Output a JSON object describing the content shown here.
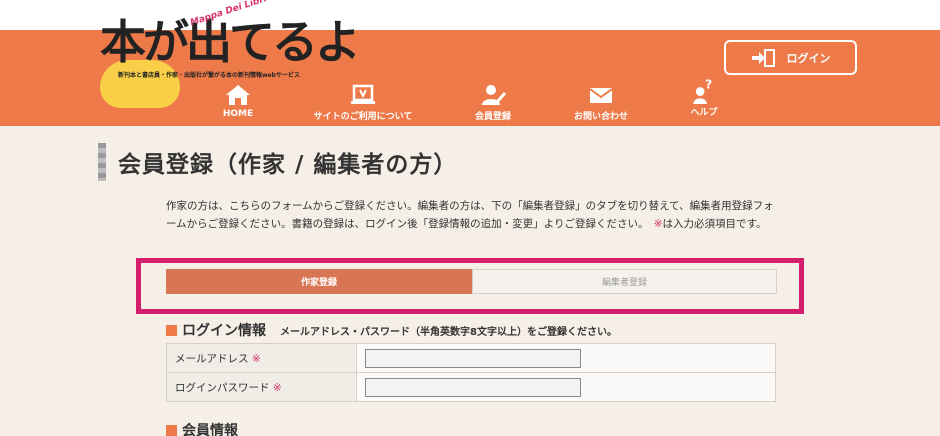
{
  "header": {
    "logo": {
      "title": "本が出てるよ",
      "arc_text": "Mappa Dei Libri .com",
      "tagline": "新刊本と書店員・作家・出版社が繋がる本の新刊情報webサービス"
    },
    "login_label": "ログイン",
    "nav": [
      {
        "label": "HOME",
        "icon": "home-icon"
      },
      {
        "label": "サイトのご利用について",
        "icon": "laptop-icon"
      },
      {
        "label": "会員登録",
        "icon": "user-pen-icon"
      },
      {
        "label": "お問い合わせ",
        "icon": "mail-icon"
      },
      {
        "label": "ヘルプ",
        "icon": "help-icon"
      }
    ]
  },
  "page": {
    "title": "会員登録（作家 / 編集者の方）",
    "intro_text": "作家の方は、こちらのフォームからご登録ください。編集者の方は、下の「編集者登録」のタブを切り替えて、編集者用登録フォームからご登録ください。書籍の登録は、ログイン後「登録情報の追加・変更」よりご登録ください。",
    "required_mark": "※",
    "required_note_suffix": "は入力必須項目です。"
  },
  "tabs": [
    {
      "label": "作家登録",
      "active": true
    },
    {
      "label": "編集者登録",
      "active": false
    }
  ],
  "login_section": {
    "heading": "ログイン情報",
    "note": "メールアドレス・パスワード（半角英数字8文字以上）をご登録ください。",
    "fields": [
      {
        "label": "メールアドレス",
        "value": ""
      },
      {
        "label": "ログインパスワード",
        "value": ""
      }
    ]
  },
  "member_section": {
    "heading": "会員情報"
  },
  "colors": {
    "header_bg": "#ee7a4a",
    "page_bg": "#f5efe7",
    "active_tab": "#d87552",
    "highlight_outline": "#d61f6c",
    "required": "#d6346e"
  }
}
